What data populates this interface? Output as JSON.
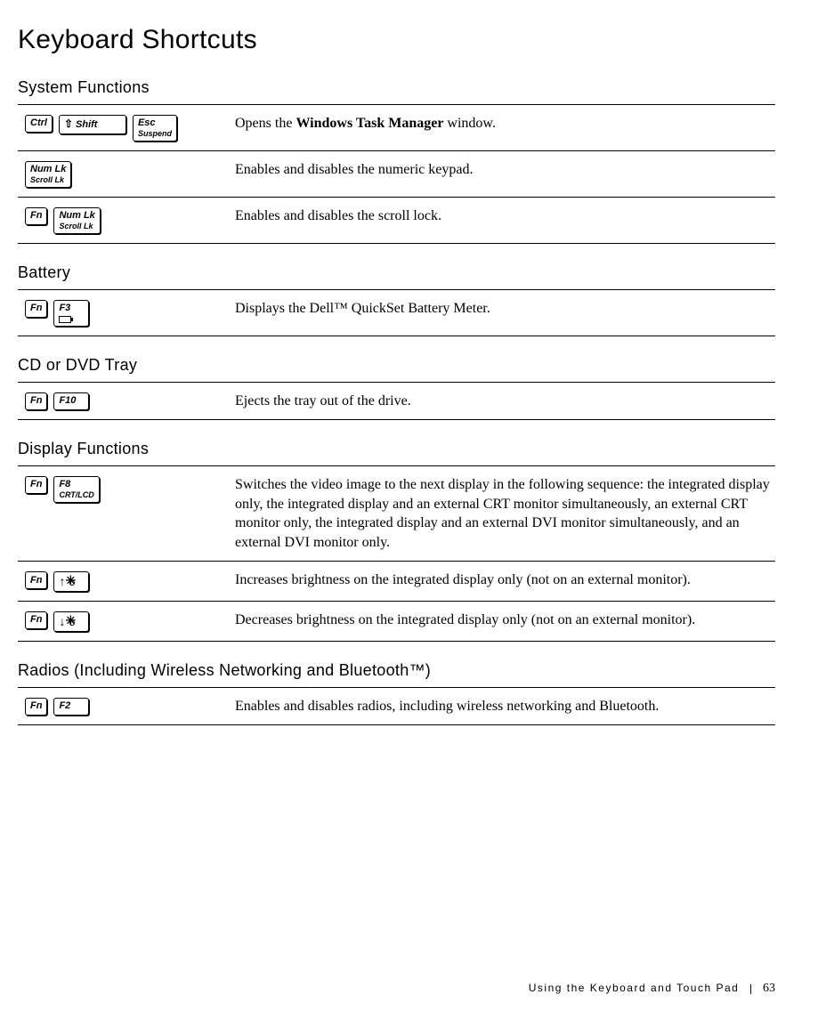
{
  "title": "Keyboard Shortcuts",
  "sections": {
    "system": {
      "heading": "System Functions",
      "rows": {
        "r0": {
          "keys": {
            "ctrl": "Ctrl",
            "shift": "Shift",
            "esc1": "Esc",
            "esc2": "Suspend"
          },
          "desc_pre": "Opens the ",
          "desc_bold": "Windows Task Manager",
          "desc_post": " window."
        },
        "r1": {
          "keys": {
            "k1a": "Num Lk",
            "k1b": "Scroll Lk"
          },
          "desc": "Enables and disables the numeric keypad."
        },
        "r2": {
          "keys": {
            "fn": "Fn",
            "k1a": "Num Lk",
            "k1b": "Scroll Lk"
          },
          "desc": "Enables and disables the scroll lock."
        }
      }
    },
    "battery": {
      "heading": "Battery",
      "rows": {
        "r0": {
          "keys": {
            "fn": "Fn",
            "f": "F3"
          },
          "desc": "Displays the Dell™ QuickSet Battery Meter."
        }
      }
    },
    "tray": {
      "heading": "CD or DVD Tray",
      "rows": {
        "r0": {
          "keys": {
            "fn": "Fn",
            "f": "F10"
          },
          "desc": "Ejects the tray out of the drive."
        }
      }
    },
    "display": {
      "heading": "Display Functions",
      "rows": {
        "r0": {
          "keys": {
            "fn": "Fn",
            "f": "F8",
            "sub": "CRT/LCD"
          },
          "desc": "Switches the video image to the next display in the following sequence: the integrated display only, the integrated display and an external CRT monitor simultaneously, an external CRT monitor only, the integrated display and an external DVI monitor simultaneously, and an external DVI monitor only."
        },
        "r1": {
          "keys": {
            "fn": "Fn"
          },
          "desc": "Increases brightness on the integrated display only (not on an external monitor)."
        },
        "r2": {
          "keys": {
            "fn": "Fn"
          },
          "desc": "Decreases brightness on the integrated display only (not on an external monitor)."
        }
      }
    },
    "radios": {
      "heading": "Radios (Including Wireless Networking and Bluetooth™)",
      "rows": {
        "r0": {
          "keys": {
            "fn": "Fn",
            "f": "F2"
          },
          "desc": "Enables and disables radios, including wireless networking and Bluetooth."
        }
      }
    }
  },
  "footer": {
    "section": "Using the Keyboard and Touch Pad",
    "page": "63"
  }
}
